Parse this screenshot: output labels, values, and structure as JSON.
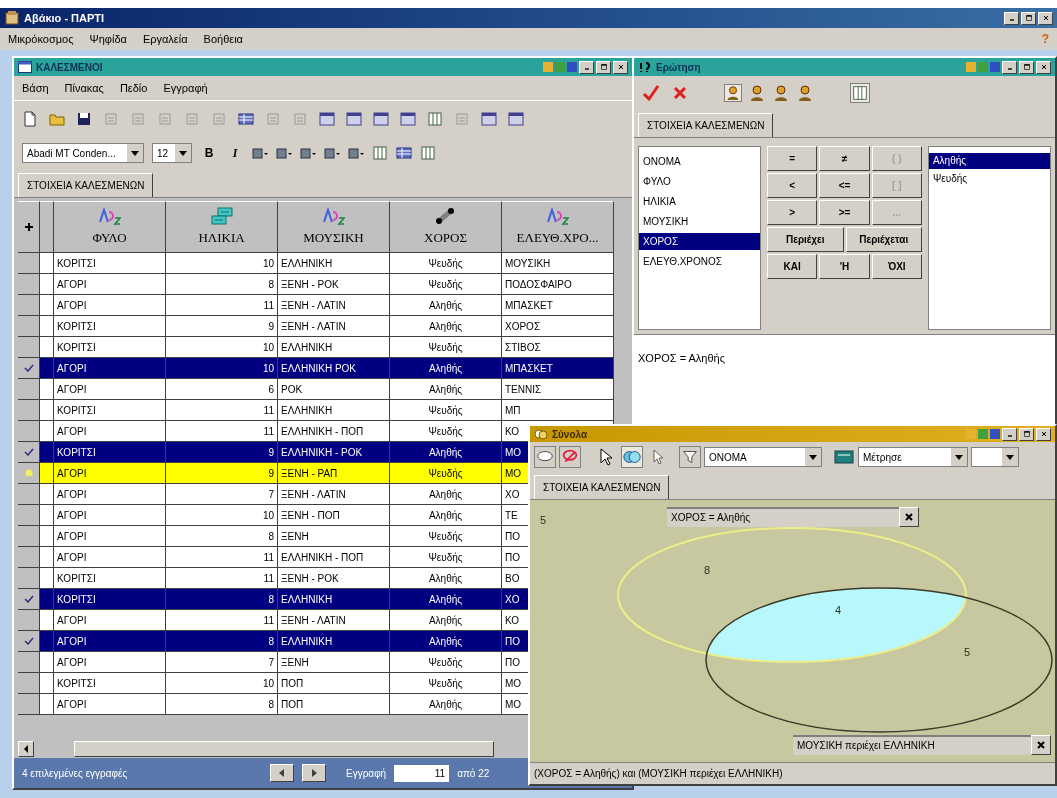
{
  "app": {
    "title": "Αβάκιο - ΠΑΡΤΙ",
    "menu": [
      "Μικρόκοσμος",
      "Ψηφίδα",
      "Εργαλεία",
      "Βοήθεια"
    ],
    "help_mark": "?"
  },
  "table_window": {
    "title": "ΚΑΛΕΣΜΕΝΟΙ",
    "menu": [
      "Βάση",
      "Πίνακας",
      "Πεδίο",
      "Εγγραφή"
    ],
    "font_name": "Abadi MT Conden...",
    "font_size": "12",
    "style_buttons": [
      "B",
      "I"
    ],
    "tab": "ΣΤΟΙΧΕΙΑ ΚΑΛΕΣΜΕΝΩΝ",
    "columns": [
      {
        "label": "ΦΥΛΟ",
        "kind": "text"
      },
      {
        "label": "ΗΛΙΚΙΑ",
        "kind": "number"
      },
      {
        "label": "ΜΟΥΣΙΚΗ",
        "kind": "text"
      },
      {
        "label": "ΧΟΡΟΣ",
        "kind": "boolean"
      },
      {
        "label": "ΕΛΕΥΘ.ΧΡΟ...",
        "kind": "text"
      }
    ],
    "rows": [
      {
        "cells": [
          "ΚΟΡΙΤΣΙ",
          "10",
          "ΕΛΛΗΝΙΚΗ",
          "Ψευδής",
          "ΜΟΥΣΙΚΗ"
        ],
        "selected": false,
        "current": false
      },
      {
        "cells": [
          "ΑΓΟΡΙ",
          "8",
          "ΞΕΝΗ - ΡΟΚ",
          "Ψευδής",
          "ΠΟΔΟΣΦΑΙΡΟ"
        ],
        "selected": false,
        "current": false
      },
      {
        "cells": [
          "ΑΓΟΡΙ",
          "11",
          "ΞΕΝΗ - ΛΑΤΙΝ",
          "Αληθής",
          "ΜΠΑΣΚΕΤ"
        ],
        "selected": false,
        "current": false
      },
      {
        "cells": [
          "ΚΟΡΙΤΣΙ",
          "9",
          "ΞΕΝΗ - ΛΑΤΙΝ",
          "Αληθής",
          "ΧΟΡΟΣ"
        ],
        "selected": false,
        "current": false
      },
      {
        "cells": [
          "ΚΟΡΙΤΣΙ",
          "10",
          "ΕΛΛΗΝΙΚΗ",
          "Ψευδής",
          "ΣΤΙΒΟΣ"
        ],
        "selected": false,
        "current": false
      },
      {
        "cells": [
          "ΑΓΟΡΙ",
          "10",
          "ΕΛΛΗΝΙΚΗ ΡΟΚ",
          "Αληθής",
          "ΜΠΑΣΚΕΤ"
        ],
        "selected": true,
        "current": false
      },
      {
        "cells": [
          "ΑΓΟΡΙ",
          "6",
          "ΡΟΚ",
          "Αληθής",
          "ΤΕΝΝΙΣ"
        ],
        "selected": false,
        "current": false
      },
      {
        "cells": [
          "ΚΟΡΙΤΣΙ",
          "11",
          "ΕΛΛΗΝΙΚΗ",
          "Ψευδής",
          "ΜΠ"
        ],
        "selected": false,
        "current": false
      },
      {
        "cells": [
          "ΑΓΟΡΙ",
          "11",
          "ΕΛΛΗΝΙΚΗ - ΠΟΠ",
          "Ψευδής",
          "ΚΟ"
        ],
        "selected": false,
        "current": false
      },
      {
        "cells": [
          "ΚΟΡΙΤΣΙ",
          "9",
          "ΕΛΛΗΝΙΚΗ - ΡΟΚ",
          "Αληθής",
          "ΜΟ"
        ],
        "selected": true,
        "current": false
      },
      {
        "cells": [
          "ΑΓΟΡΙ",
          "9",
          "ΞΕΝΗ - ΡΑΠ",
          "Ψευδής",
          "ΜΟ"
        ],
        "selected": false,
        "current": true
      },
      {
        "cells": [
          "ΑΓΟΡΙ",
          "7",
          "ΞΕΝΗ - ΛΑΤΙΝ",
          "Αληθής",
          "ΧΟ"
        ],
        "selected": false,
        "current": false
      },
      {
        "cells": [
          "ΑΓΟΡΙ",
          "10",
          "ΞΕΝΗ - ΠΟΠ",
          "Αληθής",
          "ΤΕ"
        ],
        "selected": false,
        "current": false
      },
      {
        "cells": [
          "ΑΓΟΡΙ",
          "8",
          "ΞΕΝΗ",
          "Ψευδής",
          "ΠΟ"
        ],
        "selected": false,
        "current": false
      },
      {
        "cells": [
          "ΑΓΟΡΙ",
          "11",
          "ΕΛΛΗΝΙΚΗ - ΠΟΠ",
          "Ψευδής",
          "ΠΟ"
        ],
        "selected": false,
        "current": false
      },
      {
        "cells": [
          "ΚΟΡΙΤΣΙ",
          "11",
          "ΞΕΝΗ - ΡΟΚ",
          "Αληθής",
          "ΒΟ"
        ],
        "selected": false,
        "current": false
      },
      {
        "cells": [
          "ΚΟΡΙΤΣΙ",
          "8",
          "ΕΛΛΗΝΙΚΗ",
          "Αληθής",
          "ΧΟ"
        ],
        "selected": true,
        "current": false
      },
      {
        "cells": [
          "ΑΓΟΡΙ",
          "11",
          "ΞΕΝΗ - ΛΑΤΙΝ",
          "Αληθής",
          "ΚΟ"
        ],
        "selected": false,
        "current": false
      },
      {
        "cells": [
          "ΑΓΟΡΙ",
          "8",
          "ΕΛΛΗΝΙΚΗ",
          "Αληθής",
          "ΠΟ"
        ],
        "selected": true,
        "current": false
      },
      {
        "cells": [
          "ΑΓΟΡΙ",
          "7",
          "ΞΕΝΗ",
          "Ψευδής",
          "ΠΟ"
        ],
        "selected": false,
        "current": false
      },
      {
        "cells": [
          "ΚΟΡΙΤΣΙ",
          "10",
          "ΠΟΠ",
          "Ψευδής",
          "ΜΟ"
        ],
        "selected": false,
        "current": false
      },
      {
        "cells": [
          "ΑΓΟΡΙ",
          "8",
          "ΠΟΠ",
          "Αληθής",
          "ΜΟ"
        ],
        "selected": false,
        "current": false
      }
    ],
    "status": "4 επιλεγμένες εγγραφές",
    "record_label": "Εγγραφή",
    "record": "11",
    "record_total": "από 22"
  },
  "query_window": {
    "title": "Ερώτηση",
    "tab": "ΣΤΟΙΧΕΙΑ ΚΑΛΕΣΜΕΝΩΝ",
    "fields": [
      {
        "label": "ΟΝΟΜΑ",
        "selected": false
      },
      {
        "label": "ΦΥΛΟ",
        "selected": false
      },
      {
        "label": "ΗΛΙΚΙΑ",
        "selected": false
      },
      {
        "label": "ΜΟΥΣΙΚΗ",
        "selected": false
      },
      {
        "label": "ΧΟΡΟΣ",
        "selected": true
      },
      {
        "label": "ΕΛΕΥΘ.ΧΡΟΝΟΣ",
        "selected": false
      }
    ],
    "operator_rows": [
      [
        {
          "label": "=",
          "disabled": false
        },
        {
          "label": "≠",
          "disabled": false
        },
        {
          "label": "( )",
          "disabled": true
        }
      ],
      [
        {
          "label": "<",
          "disabled": false
        },
        {
          "label": "<=",
          "disabled": false
        },
        {
          "label": "[ ]",
          "disabled": true
        }
      ],
      [
        {
          "label": ">",
          "disabled": false
        },
        {
          "label": ">=",
          "disabled": false
        },
        {
          "label": "...",
          "disabled": true
        }
      ],
      [
        {
          "label": "Περιέχει",
          "disabled": false
        },
        {
          "label": "Περιέχεται",
          "disabled": false
        }
      ],
      [
        {
          "label": "ΚΑΙ",
          "disabled": false
        },
        {
          "label": "'Η",
          "disabled": false
        },
        {
          "label": "ΌΧΙ",
          "disabled": false
        }
      ]
    ],
    "values": [
      {
        "label": "Αληθής",
        "selected": true
      },
      {
        "label": "Ψευδής",
        "selected": false
      }
    ],
    "expression": "ΧΟΡΟΣ = Αληθής"
  },
  "sets_window": {
    "title": "Σύνολα",
    "field_dropdown": "ΟΝΟΜΑ",
    "measure_dropdown": "Μέτρησε",
    "tab": "ΣΤΟΙΧΕΙΑ ΚΑΛΕΣΜΕΝΩΝ",
    "sets": [
      {
        "label": "ΧΟΡΟΣ = Αληθής",
        "color": "#eeee88"
      },
      {
        "label": "ΜΟΥΣΙΚΗ περιέχει ΕΛΛΗΝΙΚΗ",
        "color": "#3a3a28"
      }
    ],
    "counts": {
      "outside": "5",
      "first_only": "8",
      "both": "4",
      "second_only": "5"
    },
    "expression": "(ΧΟΡΟΣ = Αληθής) και (ΜΟΥΣΙΚΗ περιέχει ΕΛΛΗΝΙΚΗ)"
  }
}
